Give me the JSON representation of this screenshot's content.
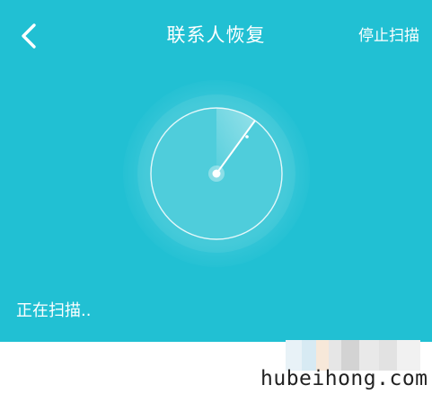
{
  "header": {
    "title": "联系人恢复",
    "stop_label": "停止扫描",
    "back_icon": "chevron-left-icon"
  },
  "scanner": {
    "icon": "radar-icon",
    "status": "正在扫描.."
  },
  "colors": {
    "background": "#21c0d3",
    "text": "#ffffff"
  },
  "watermark": {
    "text": "hubeihong.com"
  }
}
